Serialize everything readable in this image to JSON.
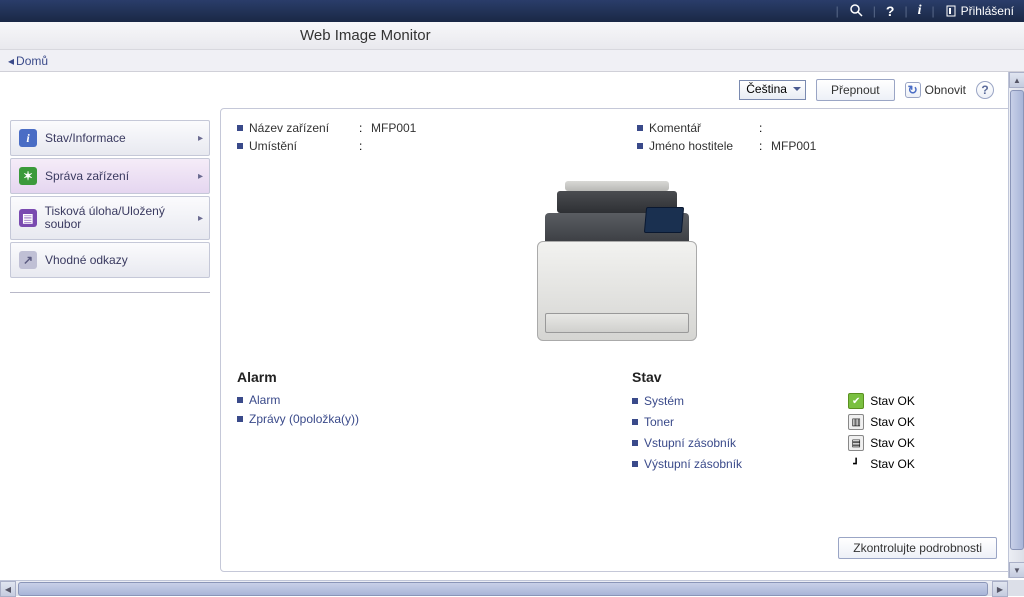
{
  "topbar": {
    "login_label": "Přihlášení"
  },
  "title": "Web Image Monitor",
  "breadcrumb": {
    "home": "Domů"
  },
  "toolbar": {
    "language": "Čeština",
    "switch_label": "Přepnout",
    "refresh_label": "Obnovit"
  },
  "sidebar": {
    "items": [
      {
        "label": "Stav/Informace",
        "icon": "info",
        "arrow": true
      },
      {
        "label": "Správa zařízení",
        "icon": "gear",
        "arrow": true,
        "selected": true
      },
      {
        "label": "Tisková úloha/Uložený soubor",
        "icon": "doc",
        "arrow": true
      },
      {
        "label": "Vhodné odkazy",
        "icon": "link",
        "arrow": false
      }
    ]
  },
  "info": {
    "device_name_label": "Název zařízení",
    "device_name_value": "MFP001",
    "location_label": "Umístění",
    "location_value": "",
    "comment_label": "Komentář",
    "comment_value": "",
    "hostname_label": "Jméno hostitele",
    "hostname_value": "MFP001"
  },
  "alarm": {
    "heading": "Alarm",
    "links": [
      {
        "label": "Alarm"
      },
      {
        "label": "Zprávy (0položka(y))"
      }
    ]
  },
  "status": {
    "heading": "Stav",
    "items": [
      {
        "label": "Systém",
        "state": "Stav OK",
        "icon": "green"
      },
      {
        "label": "Toner",
        "state": "Stav OK",
        "icon": "bars"
      },
      {
        "label": "Vstupní zásobník",
        "state": "Stav OK",
        "icon": "tray"
      },
      {
        "label": "Výstupní zásobník",
        "state": "Stav OK",
        "icon": "out"
      }
    ]
  },
  "details_button": "Zkontrolujte podrobnosti"
}
